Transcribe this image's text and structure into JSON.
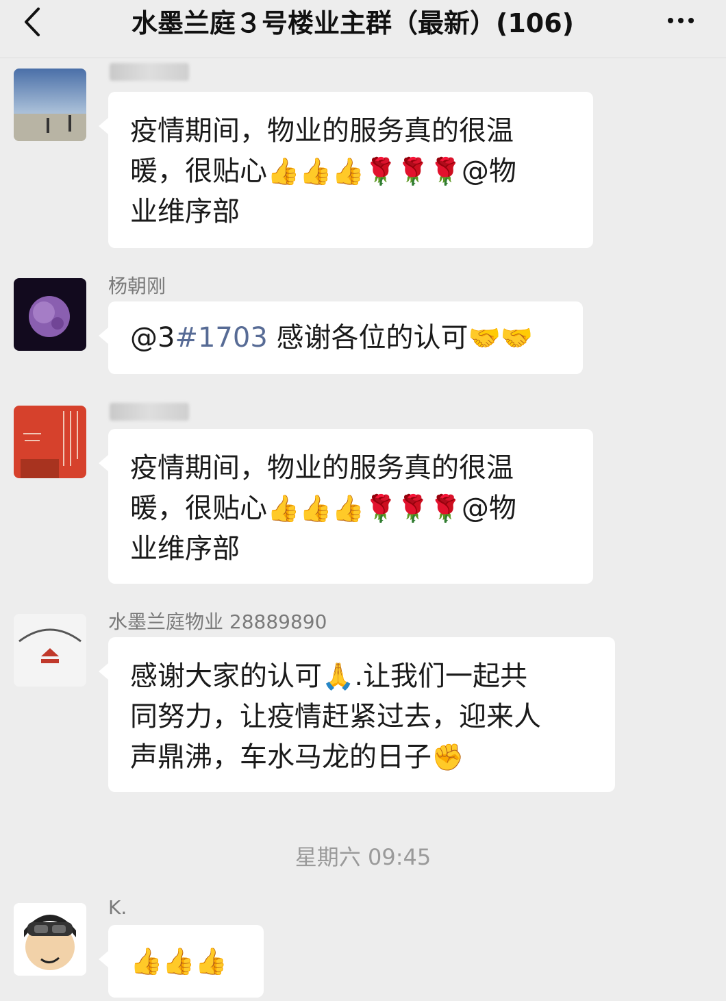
{
  "header": {
    "title": "水墨兰庭３号楼业主群（最新）(106)",
    "back_icon": "chevron-left-icon",
    "more_icon": "more-dots-icon"
  },
  "messages": [
    {
      "sender": "",
      "text_line1": "疫情期间，物业的服务真的很温",
      "text_line2_prefix": "暖，很贴心",
      "emojis": "👍👍👍🌹🌹🌹",
      "text_line2_suffix": "@物",
      "text_line3": "业维序部"
    },
    {
      "sender": "杨朝刚",
      "mention_prefix": "@3",
      "mention_num": "#1703",
      "text": " 感谢各位的认可",
      "emojis": "🤝🤝"
    },
    {
      "sender": "",
      "text_line1": "疫情期间，物业的服务真的很温",
      "text_line2_prefix": "暖，很贴心",
      "emojis": "👍👍👍🌹🌹🌹",
      "text_line2_suffix": "@物",
      "text_line3": "业维序部"
    },
    {
      "sender": "水墨兰庭物业 28889890",
      "text_line1_prefix": "感谢大家的认可",
      "emoji1": "🙏",
      "text_line1_suffix": ".让我们一起共",
      "text_line2": "同努力，让疫情赶紧过去，迎来人",
      "text_line3": "声鼎沸，车水马龙的日子",
      "emoji2": "✊"
    },
    {
      "sender": "K.",
      "emojis": "👍👍👍"
    }
  ],
  "timestamp": "星期六 09:45",
  "colors": {
    "background": "#ededed",
    "bubble": "#ffffff",
    "mention": "#576b95"
  }
}
